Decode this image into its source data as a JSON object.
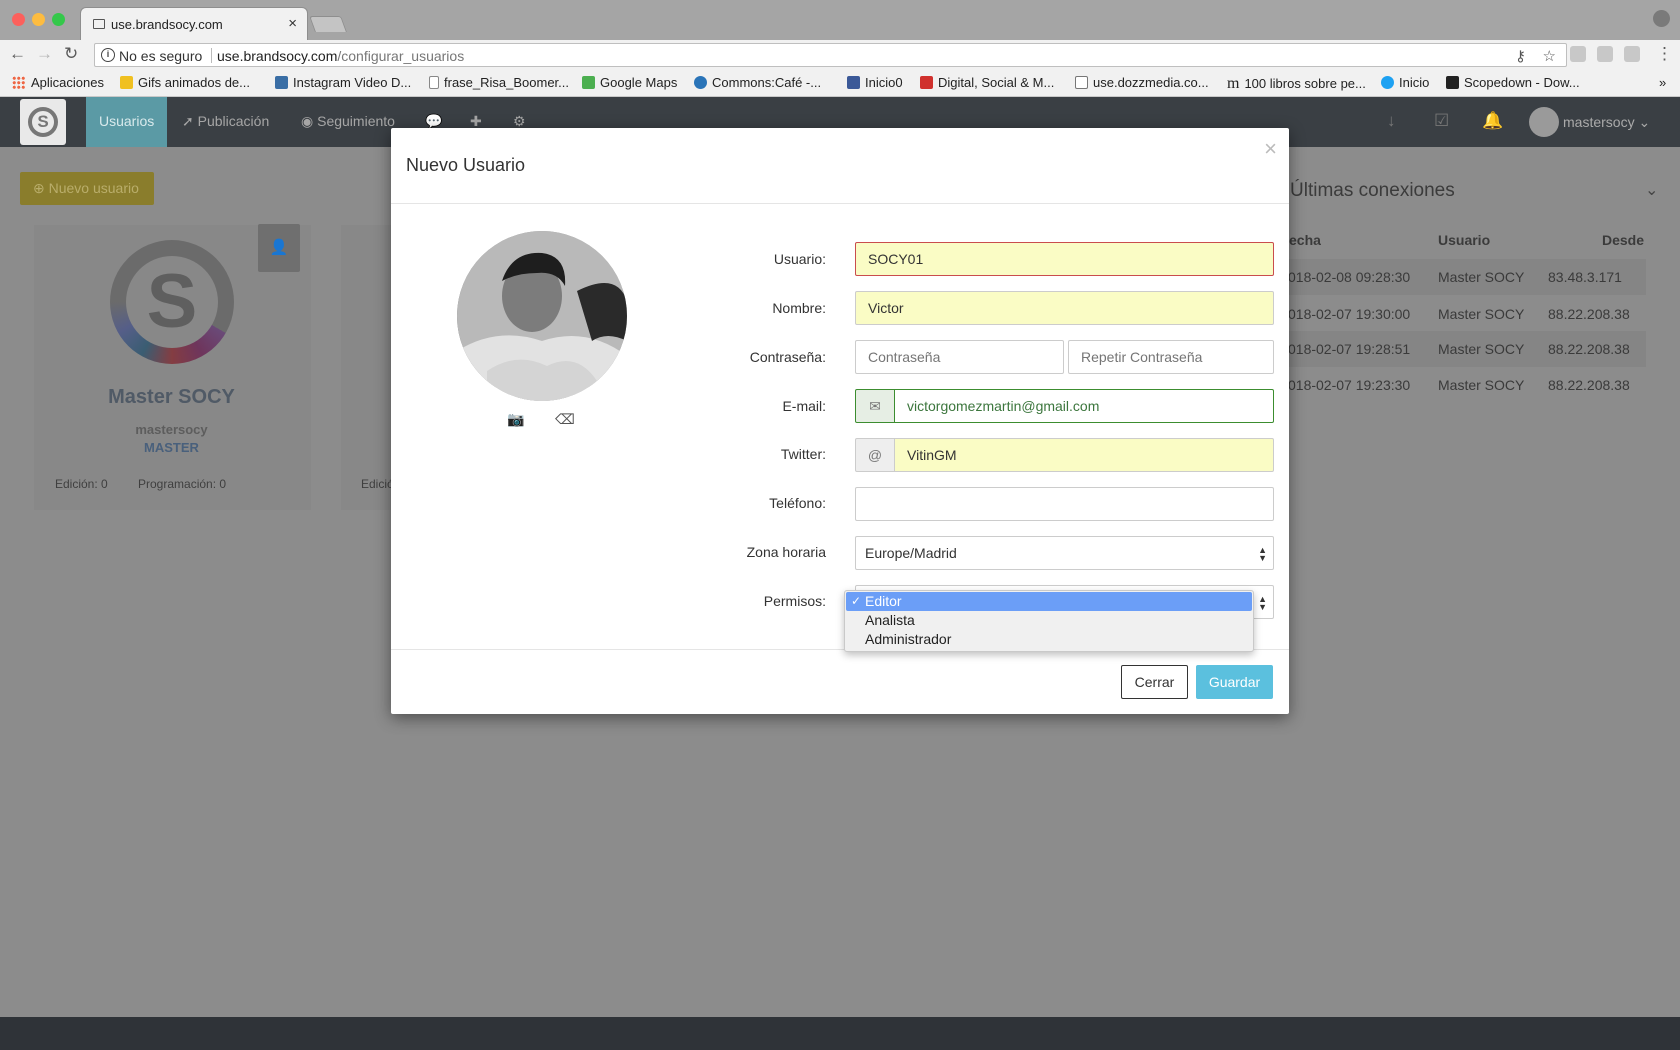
{
  "browser": {
    "tab_title": "use.brandsocy.com",
    "tab_close": "×",
    "security_label": "No es seguro",
    "url_host": "use.brandsocy.com",
    "url_path": "/configurar_usuarios",
    "bookmarks": [
      "Aplicaciones",
      "Gifs animados de...",
      "Instagram Video D...",
      "frase_Risa_Boomer...",
      "Google Maps",
      "Commons:Café -...",
      "Inicio0",
      "Digital, Social & M...",
      "use.dozzmedia.co...",
      "100 libros sobre pe...",
      "Inicio",
      "Scopedown - Dow..."
    ],
    "bookmarks_overflow": "»"
  },
  "app_nav": {
    "items": [
      "Usuarios",
      "Publicación",
      "Seguimiento"
    ],
    "user": "mastersocy",
    "user_chevron": "⌄"
  },
  "background": {
    "new_user_button": "Nuevo usuario",
    "card": {
      "name": "Master SOCY",
      "username": "mastersocy",
      "role": "MASTER",
      "edicion": "Edición: 0",
      "programacion": "Programación: 0",
      "card2_partial": "Edició"
    },
    "connections": {
      "title": "Últimas conexiones",
      "headers": [
        "echa",
        "Usuario",
        "Desde"
      ],
      "rows": [
        [
          "018-02-08 09:28:30",
          "Master SOCY",
          "83.48.3.171"
        ],
        [
          "018-02-07 19:30:00",
          "Master SOCY",
          "88.22.208.38"
        ],
        [
          "018-02-07 19:28:51",
          "Master SOCY",
          "88.22.208.38"
        ],
        [
          "018-02-07 19:23:30",
          "Master SOCY",
          "88.22.208.38"
        ]
      ]
    }
  },
  "modal": {
    "title": "Nuevo Usuario",
    "close": "×",
    "labels": {
      "usuario": "Usuario:",
      "nombre": "Nombre:",
      "contrasena": "Contraseña:",
      "email": "E-mail:",
      "twitter": "Twitter:",
      "telefono": "Teléfono:",
      "zona": "Zona horaria",
      "permisos": "Permisos:"
    },
    "values": {
      "usuario": "SOCY01",
      "nombre": "Victor",
      "email": "victorgomezmartin@gmail.com",
      "twitter": "VitinGM",
      "telefono": "",
      "zona": "Europe/Madrid"
    },
    "placeholders": {
      "contrasena": "Contraseña",
      "repetir": "Repetir Contraseña"
    },
    "twitter_addon": "@",
    "permisos_options": [
      "Editor",
      "Analista",
      "Administrador"
    ],
    "permisos_selected": "Editor",
    "buttons": {
      "cerrar": "Cerrar",
      "guardar": "Guardar"
    }
  },
  "colors": {
    "accent": "#5bc0de",
    "error_border": "#c94d4d",
    "success_border": "#3c8d2f",
    "autofill_bg": "#fafcc5",
    "dropdown_selected": "#6b9ef7"
  }
}
